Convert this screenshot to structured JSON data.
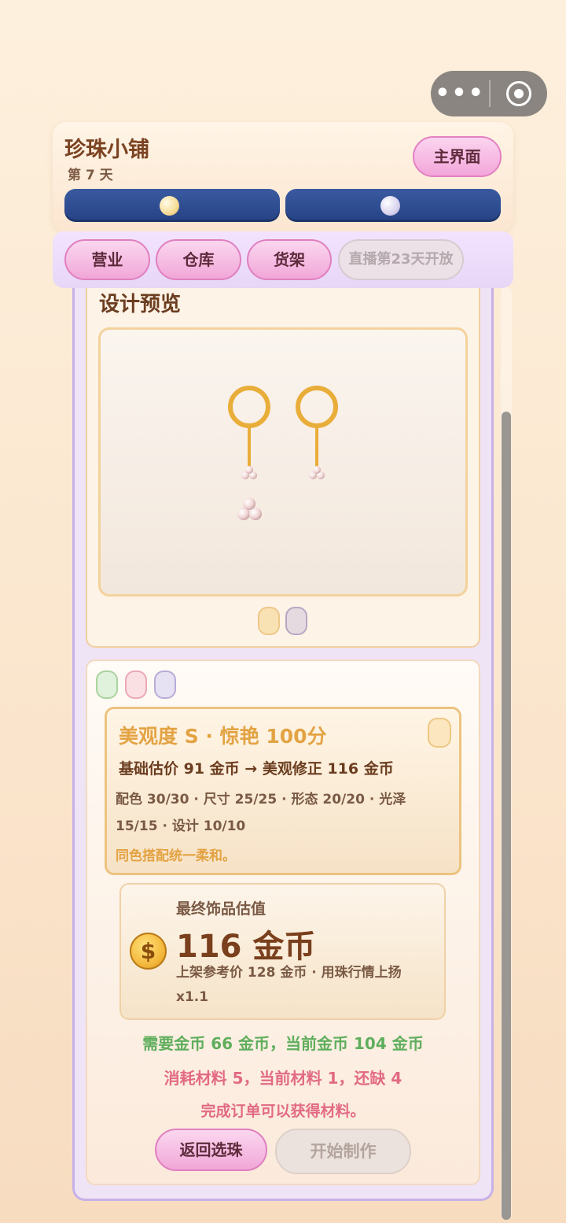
{
  "capsule": {
    "menu_icon": "more-dots-icon",
    "close_icon": "target-icon",
    "dots": "•••"
  },
  "header": {
    "title": "珍珠小铺",
    "day": "第 7 天",
    "main_button": "主界面"
  },
  "tabs": [
    {
      "label": "营业",
      "enabled": true
    },
    {
      "label": "仓库",
      "enabled": true
    },
    {
      "label": "货架",
      "enabled": true
    },
    {
      "label": "直播第23天开放",
      "enabled": false
    }
  ],
  "preview": {
    "title": "设计预览"
  },
  "score": {
    "title": "美观度 S · 惊艳 100分",
    "price_line": "基础估价 91 金币 → 美观修正 116 金币",
    "breakdown": "配色 30/30 · 尺寸 25/25 · 形态 20/20 · 光泽 15/15 · 设计 10/10",
    "note": "同色搭配统一柔和。"
  },
  "valuation": {
    "label": "最终饰品估值",
    "amount": "116 金币",
    "sub": "上架参考价 128 金币 · 用珠行情上扬 x1.1",
    "coin_symbol": "$"
  },
  "messages": {
    "coins": "需要金币 66 金币，当前金币 104 金币",
    "materials": "消耗材料 5，当前材料 1，还缺 4",
    "hint": "完成订单可以获得材料。"
  },
  "buttons": {
    "back": "返回选珠",
    "start": "开始制作"
  },
  "colors": {
    "accent_pink": "#f1a7d8",
    "bar_blue": "#2f4f92",
    "gold": "#e3a343",
    "green": "#5fae5c",
    "red": "#e26a83"
  }
}
